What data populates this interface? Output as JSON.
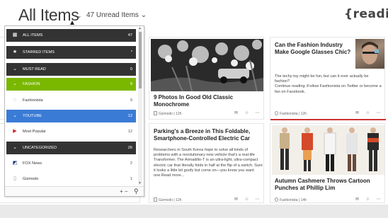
{
  "header": {
    "title": "All Items",
    "title_chevron": "⌄",
    "unread_filter": "47 Unread Items ⌄",
    "logo": "{readiy}"
  },
  "dropdown": {
    "rows": [
      {
        "icon": "grid-icon",
        "glyph": "▦",
        "label": "ALL ITEMS",
        "count": "47",
        "style": "dark"
      },
      {
        "icon": "star-icon",
        "glyph": "★",
        "label": "STARRED ITEMS",
        "count": "*",
        "style": "dark"
      },
      {
        "icon": "chevron-down-icon",
        "glyph": "⌄",
        "label": "MUST READ",
        "count": "0",
        "style": "dark"
      },
      {
        "icon": "chevron-down-icon",
        "glyph": "⌄",
        "label": "FASHION",
        "count": "9",
        "style": "green"
      },
      {
        "icon": "rss-icon",
        "glyph": "◌",
        "label": "Fashionista",
        "count": "9",
        "style": "plain"
      },
      {
        "icon": "chevron-down-icon",
        "glyph": "⌄",
        "label": "YOUTUBE",
        "count": "12",
        "style": "blue"
      },
      {
        "icon": "youtube-icon",
        "glyph": "▶",
        "label": "Most Popular",
        "count": "12",
        "style": "plain"
      },
      {
        "icon": "chevron-down-icon",
        "glyph": "⌄",
        "label": "UNCATEGORIZED",
        "count": "26",
        "style": "dark"
      },
      {
        "icon": "fox-news-icon",
        "glyph": "◩",
        "label": "FOX News",
        "count": "2",
        "style": "plain"
      },
      {
        "icon": "gizmodo-icon",
        "glyph": "▯",
        "label": "Gizmodo",
        "count": "1",
        "style": "plain"
      }
    ],
    "add_remove": "+ −",
    "filter": "⚲"
  },
  "cards": {
    "monochrome": {
      "title": "9 Photos In Good Old Classic Monochrome",
      "source": "Gizmodo | 12h"
    },
    "fashion_glasses": {
      "title": "Can the Fashion Industry Make Google Glasses Chic?",
      "text": "The techy toy might be fun, but can it ever actually be fashion?\nContinue reading ›Follow Fashionista on Twitter or become a fan on Facebook.",
      "source": "Fashionista | 12h"
    },
    "parking": {
      "title": "Parking's a Breeze in This Foldable, Smartphone-Controlled Electric Car",
      "text": "Researchers in South Korea hope to solve all kinds of problems with a revolutionary new vehicle that's a real-life Transformer. The Armadillo-T is an ultra-light, ultra-compact electric car that literally folds in half at the flip of a switch. Sure it looks a little bit goofy but come on—you know you want one.Read more...",
      "source": "Gizmodo | 12h"
    },
    "autumn": {
      "title": "Autumn Cashmere Throws Cartoon Punches at Phillip Lim",
      "source": "Fashionista | 14h"
    }
  },
  "footer_icons": "✉ ☆ ⋯",
  "colors": {
    "dark": "#333333",
    "fashion": "#7ab800",
    "youtube": "#3a7bd5",
    "accent_red": "#cc3333",
    "accent_blue": "#3a7bd5"
  }
}
